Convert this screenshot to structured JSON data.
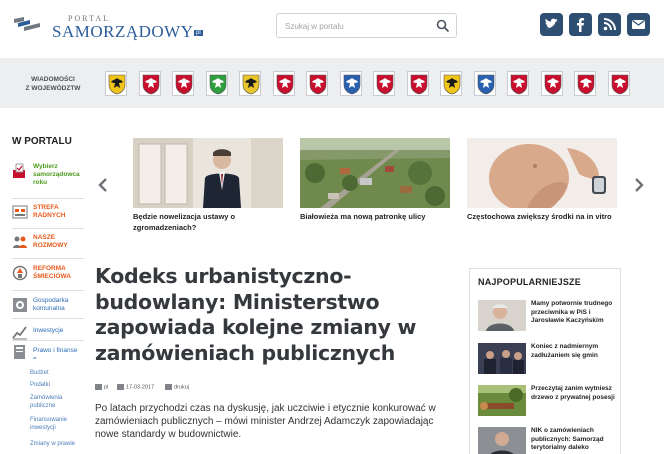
{
  "header": {
    "logo_small": "PORTAL",
    "logo_brand": "SAMORZĄDOWY",
    "logo_suffix": "pl",
    "search_placeholder": "Szukaj w portalu",
    "social": [
      "twitter-icon",
      "facebook-icon",
      "rss-icon",
      "email-icon"
    ]
  },
  "regions": {
    "label_line1": "WIADOMOŚCI",
    "label_line2": "Z WOJEWÓDZTW",
    "crests": [
      {
        "name": "dolnoslaskie",
        "color": "#f0c419"
      },
      {
        "name": "kujawsko-pomorskie",
        "color": "#c8102e"
      },
      {
        "name": "lubelskie",
        "color": "#c8102e"
      },
      {
        "name": "lubuskie",
        "color": "#2e9e3e"
      },
      {
        "name": "lodzkie",
        "color": "#e8c52b"
      },
      {
        "name": "malopolskie",
        "color": "#c8102e"
      },
      {
        "name": "mazowieckie",
        "color": "#c8102e"
      },
      {
        "name": "opolskie",
        "color": "#2a60b0"
      },
      {
        "name": "podkarpackie",
        "color": "#c8102e"
      },
      {
        "name": "podlaskie",
        "color": "#c8102e"
      },
      {
        "name": "pomorskie",
        "color": "#f0c419"
      },
      {
        "name": "slaskie",
        "color": "#2a60b0"
      },
      {
        "name": "swietokrzyskie",
        "color": "#c8102e"
      },
      {
        "name": "warminsko-mazurskie",
        "color": "#c8102e"
      },
      {
        "name": "wielkopolskie",
        "color": "#c8102e"
      },
      {
        "name": "zachodniopomorskie",
        "color": "#c8102e"
      }
    ]
  },
  "sidebar": {
    "title": "W PORTALU",
    "items": [
      {
        "label": "Wybierz samorządowca roku",
        "color": "#4d9a1e"
      },
      {
        "label": "STREFA RADNYCH",
        "color": "#e85a1c"
      },
      {
        "label": "NASZE ROZMOWY",
        "color": "#e85a1c"
      },
      {
        "label": "REFORMA ŚMIECIOWA",
        "color": "#e85a1c"
      },
      {
        "label": "Gospodarka komunalna",
        "color": "#2a6db5"
      },
      {
        "label": "Inwestycje",
        "color": "#2a6db5"
      },
      {
        "label": "Prawo i finanse",
        "color": "#2a6db5"
      }
    ],
    "subitems": [
      "Budżet",
      "Podatki",
      "Zamówienia publiczne",
      "Finansowanie inwestycji",
      "Zmiany w prawie"
    ]
  },
  "carousel": {
    "cards": [
      {
        "caption": "Będzie nowelizacja ustawy o zgromadzeniach?"
      },
      {
        "caption": "Białowieża ma nową patronkę ulicy"
      },
      {
        "caption": "Częstochowa zwiększy środki na in vitro"
      }
    ]
  },
  "article": {
    "title": "Kodeks urbanistyczno-budowlany: Ministerstwo zapowiada kolejne zmiany w zamówieniach publicznych",
    "meta_lang": "pl",
    "meta_date": "17-03-2017",
    "meta_print": "drukuj",
    "lead": "Po latach przychodzi czas na dyskusję, jak uczciwie i etycznie konkurować w zamówieniach publicznych – mówi minister Andrzej Adamczyk zapowiadając nowe standardy w budownictwie."
  },
  "popular": {
    "title": "NAJPOPULARNIEJSZE",
    "items": [
      {
        "text": "Mamy potwornie trudnego przeciwnika w PiS i Jarosławie Kaczyńskim"
      },
      {
        "text": "Koniec z nadmiernym zadłużaniem się gmin"
      },
      {
        "text": "Przeczytaj zanim wytniesz drzewo z prywatnej posesji"
      },
      {
        "text": "NIK o zamówieniach publicznych: Samorząd terytorialny daleko"
      }
    ]
  }
}
